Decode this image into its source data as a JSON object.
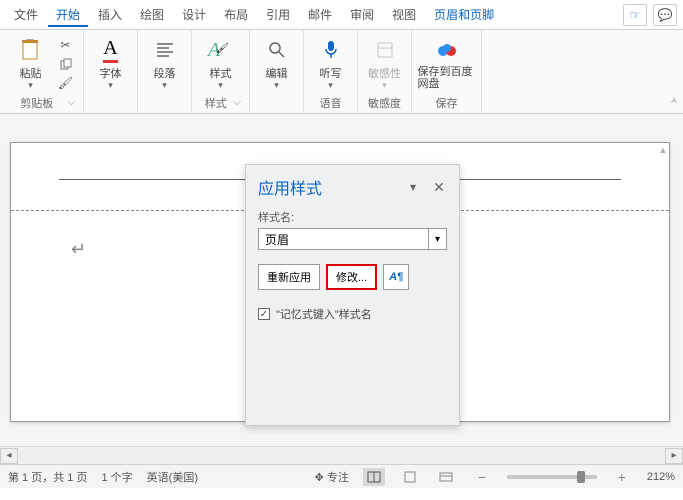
{
  "tabs": {
    "file": "文件",
    "home": "开始",
    "insert": "插入",
    "draw": "绘图",
    "design": "设计",
    "layout": "布局",
    "references": "引用",
    "mail": "邮件",
    "review": "审阅",
    "view": "视图",
    "header_footer": "页眉和页脚"
  },
  "share_icon": "☞",
  "comment_icon": "💬",
  "ribbon": {
    "paste": "粘贴",
    "clipboard_group": "剪贴板",
    "font": "字体",
    "paragraph": "段落",
    "styles": "样式",
    "styles_group": "样式",
    "edit": "编辑",
    "dictate": "听写",
    "voice_group": "语音",
    "sensitivity": "敏感性",
    "sensitivity_group": "敏感度",
    "baidu": "保存到百度网盘",
    "baidu_group": "保存"
  },
  "pane": {
    "title": "应用样式",
    "style_name_label": "样式名:",
    "style_value": "页眉",
    "reapply": "重新应用",
    "modify": "修改...",
    "aa_icon": "A¶",
    "checkbox_label": "\"记忆式键入\"样式名"
  },
  "status": {
    "page": "第 1 页，共 1 页",
    "words": "1 个字",
    "lang": "英语(美国)",
    "focus": "专注",
    "zoom": "212%"
  },
  "para_glyph": "↵"
}
